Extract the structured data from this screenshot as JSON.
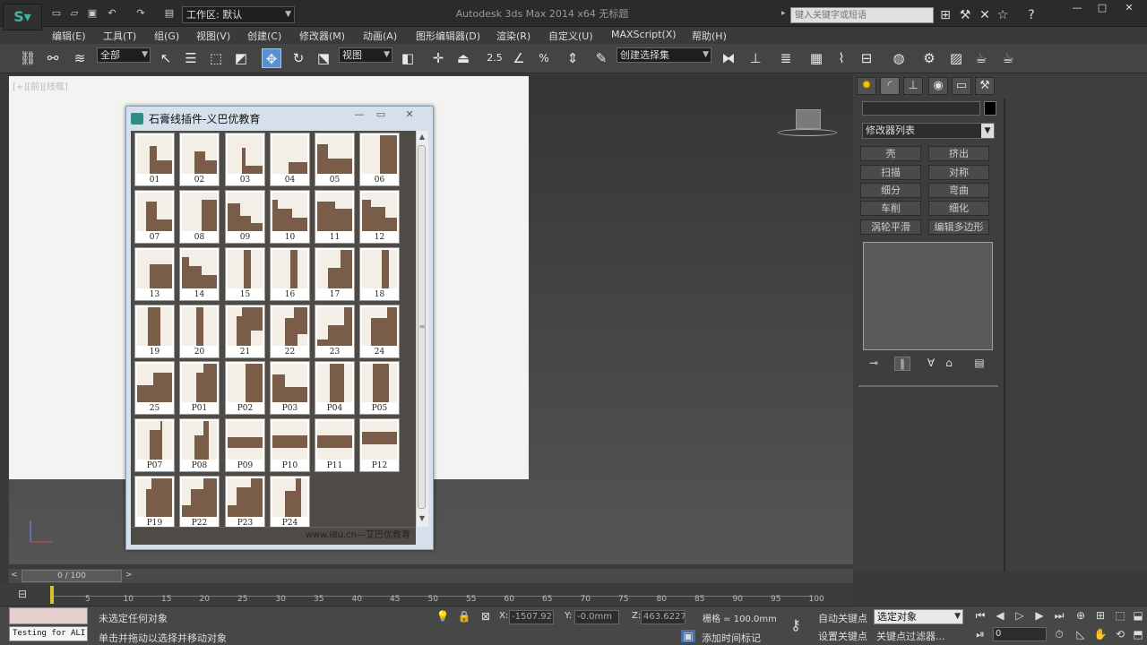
{
  "titlebar": {
    "workspace": "工作区: 默认",
    "title": "Autodesk 3ds Max  2014 x64       无标题",
    "search_placeholder": "键入关键字或短语"
  },
  "menu": [
    "编辑(E)",
    "工具(T)",
    "组(G)",
    "视图(V)",
    "创建(C)",
    "修改器(M)",
    "动画(A)",
    "图形编辑器(D)",
    "渲染(R)",
    "自定义(U)",
    "MAXScript(X)",
    "帮助(H)"
  ],
  "toolbar": {
    "filter": "全部",
    "refcoord": "视图",
    "snap_num": "2.5",
    "selection_set": "创建选择集"
  },
  "viewport": {
    "label": "[+][前][线框]"
  },
  "plugin": {
    "title": "石膏线插件-义巴优教育",
    "footer": "www.i8u.cn—艾巴优教育",
    "tiles": [
      "01",
      "02",
      "03",
      "04",
      "05",
      "06",
      "07",
      "08",
      "09",
      "10",
      "11",
      "12",
      "13",
      "14",
      "15",
      "16",
      "17",
      "18",
      "19",
      "20",
      "21",
      "22",
      "23",
      "24",
      "25",
      "P01",
      "P02",
      "P03",
      "P04",
      "P05",
      "P07",
      "P08",
      "P09",
      "P10",
      "P11",
      "P12",
      "P19",
      "P22",
      "P23",
      "P24"
    ]
  },
  "command_panel": {
    "modifier_list": "修改器列表",
    "buttons": [
      "壳",
      "挤出",
      "扫描",
      "对称",
      "细分",
      "弯曲",
      "车削",
      "细化",
      "涡轮平滑",
      "编辑多边形"
    ]
  },
  "timeline": {
    "slider": "0 / 100",
    "ticks": [
      "5",
      "10",
      "15",
      "20",
      "25",
      "30",
      "35",
      "40",
      "45",
      "50",
      "55",
      "60",
      "65",
      "70",
      "75",
      "80",
      "85",
      "90",
      "95",
      "100"
    ]
  },
  "status": {
    "listener": "Testing for ALI",
    "line1": "未选定任何对象",
    "line2": "单击并拖动以选择并移动对象",
    "x_label": "X:",
    "x_value": "-1507.922",
    "y_label": "Y:",
    "y_value": "-0.0mm",
    "z_label": "Z:",
    "z_value": "463.6227m",
    "grid": "栅格 = 100.0mm",
    "add_time_tag": "添加时间标记",
    "auto_key": "自动关键点",
    "set_key": "设置关键点",
    "selected_object": "选定对象",
    "key_filters": "关键点过滤器...",
    "frame": "0"
  }
}
